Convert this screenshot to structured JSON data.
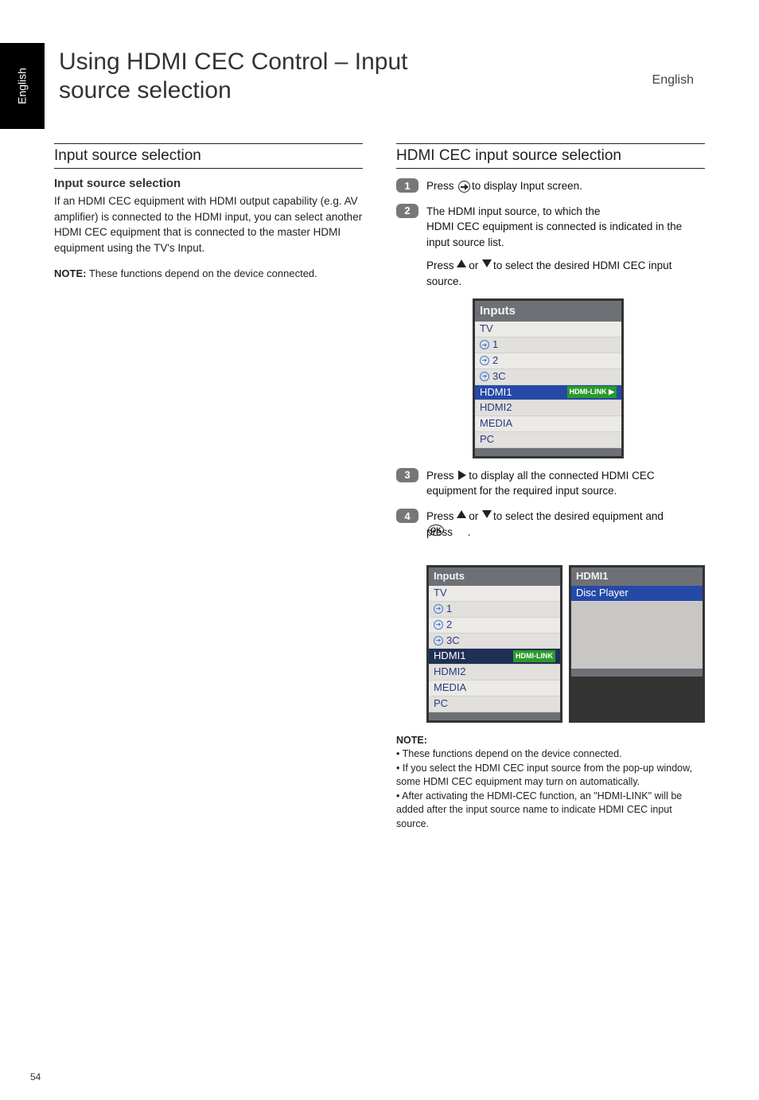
{
  "tab_text": "English",
  "right_lang": "English",
  "page_number": "54",
  "title": "Using HDMI CEC Control – Input\nsource selection",
  "left": {
    "heading": "Input source selection",
    "sect1_title": "Input source selection",
    "sect1_body": "If an HDMI CEC equipment with HDMI output capability (e.g. AV amplifier) is connected to the HDMI input, you can select another HDMI CEC equipment that is connected to the master HDMI equipment using the TV's Input.",
    "note_label": "NOTE:",
    "note_body": "These functions depend on the device connected."
  },
  "right": {
    "heading": "HDMI CEC input source selection",
    "step1": "Press      to display Input screen.",
    "step2_line1": "The HDMI input source, to which the",
    "step2_line2": "HDMI CEC equipment is connected is indicated in the input source list.",
    "step2_line3": "Press     or     to select the desired HDMI CEC input source.",
    "step3": "Press     to display all the connected HDMI CEC equipment for the required input source.",
    "step4": "Press     or     to select the desired equipment and press     .",
    "ok_label": "OK",
    "badge1": "1",
    "badge2": "2",
    "badge3": "3",
    "badge4": "4",
    "note_label": "NOTE:",
    "note1": "These functions depend on the device connected.",
    "note2": "If you select the HDMI CEC input source from the pop-up window, some HDMI CEC equipment may turn on automatically.",
    "note3": "After activating the HDMI-CEC function, an \"HDMI-LINK\" will be added after the input source name to indicate HDMI CEC input source.",
    "osd": {
      "title": "Inputs",
      "items": [
        "TV",
        "1",
        "2",
        "3C",
        "HDMI1",
        "HDMI2",
        "MEDIA",
        "PC"
      ],
      "hdmi_link": "HDMI-LINK",
      "panel2_title": "HDMI1",
      "panel2_item": "Disc Player"
    }
  }
}
